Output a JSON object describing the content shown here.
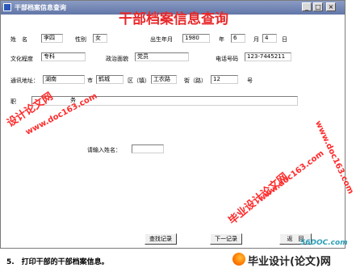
{
  "window": {
    "title": "干部档案信息查询",
    "minimize": "_",
    "maximize": "□",
    "close": "×"
  },
  "form": {
    "heading": "干部档案信息查询",
    "name_label": "姓　名",
    "name_value": "李四",
    "gender_label": "性别",
    "gender_value": "女",
    "birth_label": "出生年月",
    "birth_year": "1980",
    "year_unit": "年",
    "birth_month": "6",
    "month_unit": "月",
    "birth_day": "4",
    "day_unit": "日",
    "education_label": "文化程度",
    "education_value": "专科",
    "politics_label": "政治面貌",
    "politics_value": "党员",
    "phone_label": "电话号码",
    "phone_value": "123-7445211",
    "address_label": "通讯地址：",
    "province_value": "湖南",
    "city_label": "市",
    "district_value": "鹤城",
    "district_label": "区（镇）",
    "town_value": "工农路",
    "street_label": "街（路）",
    "house_value": "12",
    "house_label": "号",
    "notes_label": "职",
    "notes_hint": "务"
  },
  "search": {
    "prompt": "请输入姓名：",
    "value": ""
  },
  "buttons": {
    "query": "查找记录",
    "next": "下一记录",
    "back": "返　回"
  },
  "watermark": {
    "site_text": "www.doc163.com",
    "cn_text": "毕业设计论文网",
    "partial_cn": "设计论文网"
  },
  "caption": "5.　打印干部的干部档案信息。",
  "footer": {
    "logo_text": "毕业设计(论文)网",
    "site": "56DOC.com"
  },
  "colors": {
    "titlebar": "#6276a8",
    "heading": "#e8282a",
    "watermark": "#ff2a2a"
  }
}
